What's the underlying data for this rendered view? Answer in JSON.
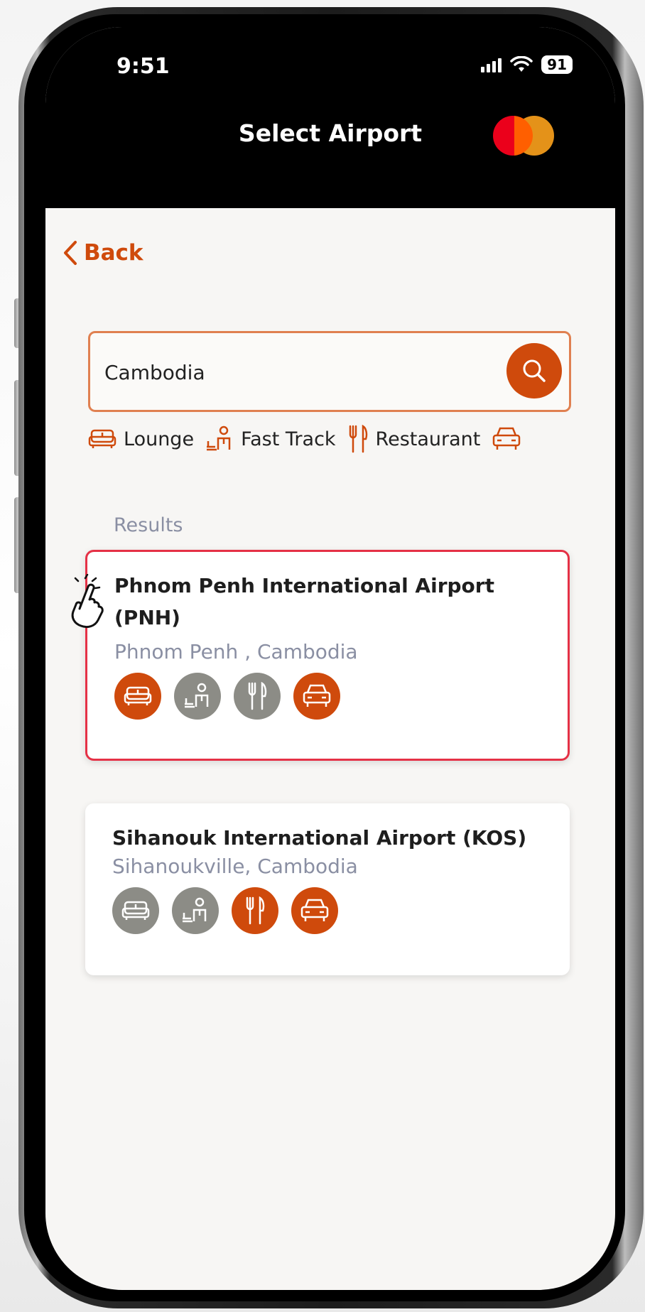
{
  "status_bar": {
    "time": "9:51",
    "battery": "91"
  },
  "header": {
    "title": "Select Airport"
  },
  "nav": {
    "back_label": "Back"
  },
  "search": {
    "value": "Cambodia",
    "placeholder": ""
  },
  "legend": {
    "items": [
      {
        "label": "Lounge",
        "icon": "sofa-icon"
      },
      {
        "label": "Fast Track",
        "icon": "fast-track-icon"
      },
      {
        "label": "Restaurant",
        "icon": "fork-knife-icon"
      },
      {
        "label": "",
        "icon": "car-icon"
      }
    ]
  },
  "results": {
    "label": "Results",
    "items": [
      {
        "name": "Phnom Penh International Airport (PNH)",
        "location": "Phnom Penh , Cambodia",
        "selected": true,
        "services": {
          "lounge": true,
          "fast_track": false,
          "restaurant": false,
          "transfer": true
        }
      },
      {
        "name": "Sihanouk International Airport (KOS)",
        "location": "Sihanoukville, Cambodia",
        "selected": false,
        "services": {
          "lounge": false,
          "fast_track": false,
          "restaurant": true,
          "transfer": true
        }
      }
    ]
  },
  "colors": {
    "accent": "#cf4a0c",
    "inactive": "#8c8c86",
    "selected_border": "#e53146",
    "muted_text": "#8a8fa3"
  }
}
